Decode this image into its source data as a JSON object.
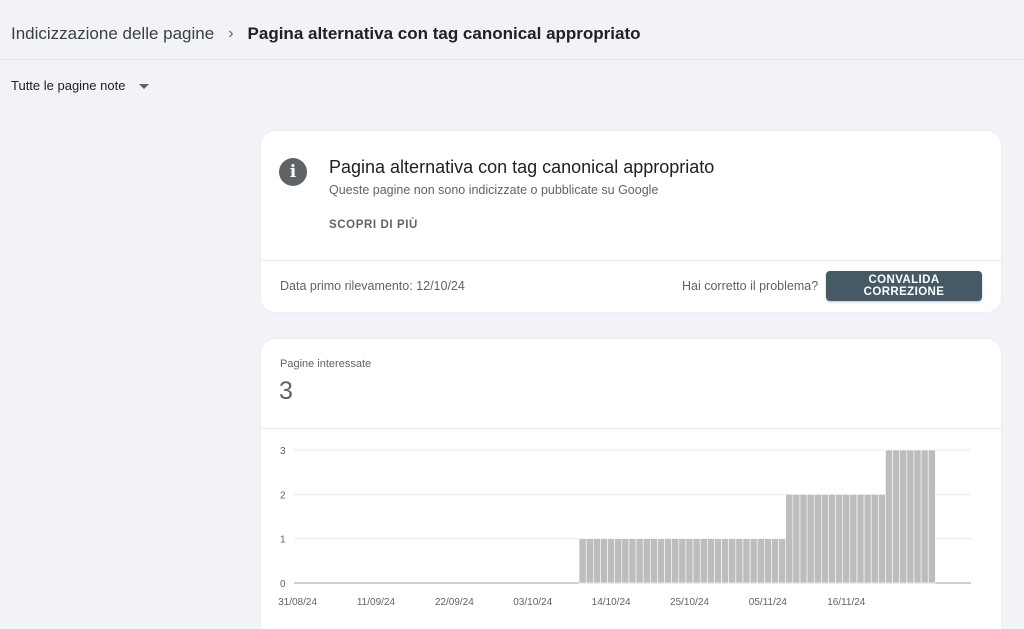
{
  "breadcrumb": {
    "parent": "Indicizzazione delle pagine",
    "separator": "›",
    "current": "Pagina alternativa con tag canonical appropriato"
  },
  "filter": {
    "label": "Tutte le pagine note"
  },
  "issue": {
    "icon": "info-icon",
    "title": "Pagina alternativa con tag canonical appropriato",
    "subtitle": "Queste pagine non sono indicizzate o pubblicate su Google",
    "learn_more": "SCOPRI DI PIÙ",
    "first_detected": "Data primo rilevamento: 12/10/24",
    "fixed_question": "Hai corretto il problema?",
    "validate_label": "CONVALIDA CORREZIONE"
  },
  "metric": {
    "label": "Pagine interessate",
    "value": "3"
  },
  "colors": {
    "bar": "#bdbdbd",
    "button": "#455a64",
    "gridline": "#e8eaed",
    "axis": "#9aa0a6"
  },
  "chart_data": {
    "type": "bar",
    "title": "",
    "xlabel": "",
    "ylabel": "",
    "ylim": [
      0,
      3
    ],
    "yticks": [
      "0",
      "1",
      "2",
      "3"
    ],
    "xtick_labels": [
      "31/08/24",
      "11/09/24",
      "22/09/24",
      "03/10/24",
      "14/10/24",
      "25/10/24",
      "05/11/24",
      "16/11/24"
    ],
    "x_start": "31/08/24",
    "x_end": "04/12/24",
    "grid": true,
    "segments": [
      {
        "from": "31/08/24",
        "to": "09/10/24",
        "value": 0
      },
      {
        "from": "10/10/24",
        "to": "07/11/24",
        "value": 1
      },
      {
        "from": "08/11/24",
        "to": "21/11/24",
        "value": 2
      },
      {
        "from": "22/11/24",
        "to": "28/11/24",
        "value": 3
      }
    ]
  }
}
